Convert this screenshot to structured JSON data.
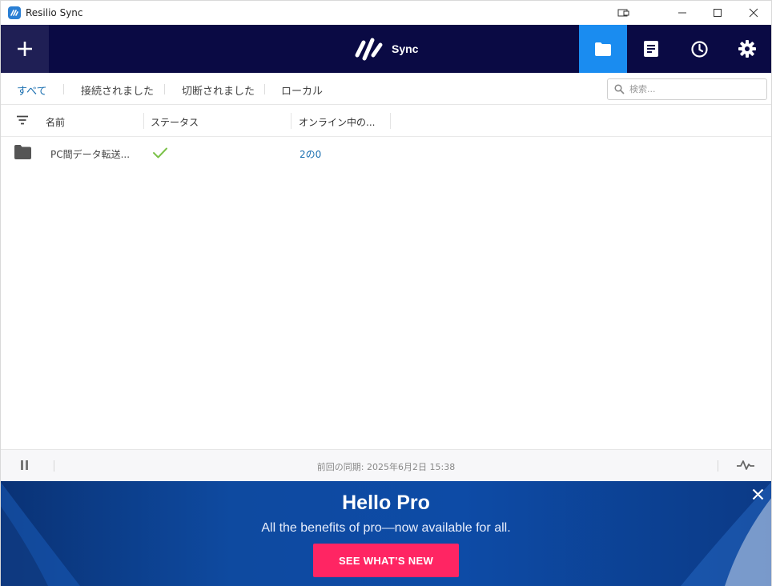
{
  "window": {
    "title": "Resilio Sync"
  },
  "header": {
    "logo_text": "Sync",
    "add_icon": "plus-icon",
    "nav": [
      {
        "icon": "folder-icon",
        "active": true
      },
      {
        "icon": "document-icon",
        "active": false
      },
      {
        "icon": "clock-icon",
        "active": false
      },
      {
        "icon": "gear-icon",
        "active": false
      }
    ],
    "colors": {
      "header_bg": "#0a0a44",
      "active_tab": "#1a8cf0"
    }
  },
  "filters": {
    "tabs": [
      "すべて",
      "接続されました",
      "切断されました",
      "ローカル"
    ],
    "active": "すべて",
    "search_placeholder": "検索..."
  },
  "columns": {
    "name": "名前",
    "status": "ステータス",
    "online": "オンライン中の..."
  },
  "rows": [
    {
      "name": "PC間データ転送...",
      "status_icon": "check-icon",
      "online": "2の0"
    }
  ],
  "statusbar": {
    "last_sync": "前回の同期: 2025年6月2日 15:38"
  },
  "promo": {
    "title": "Hello Pro",
    "subtitle": "All the benefits of pro—now available for all.",
    "cta": "SEE WHAT’S NEW",
    "cta_color": "#ff2563"
  }
}
